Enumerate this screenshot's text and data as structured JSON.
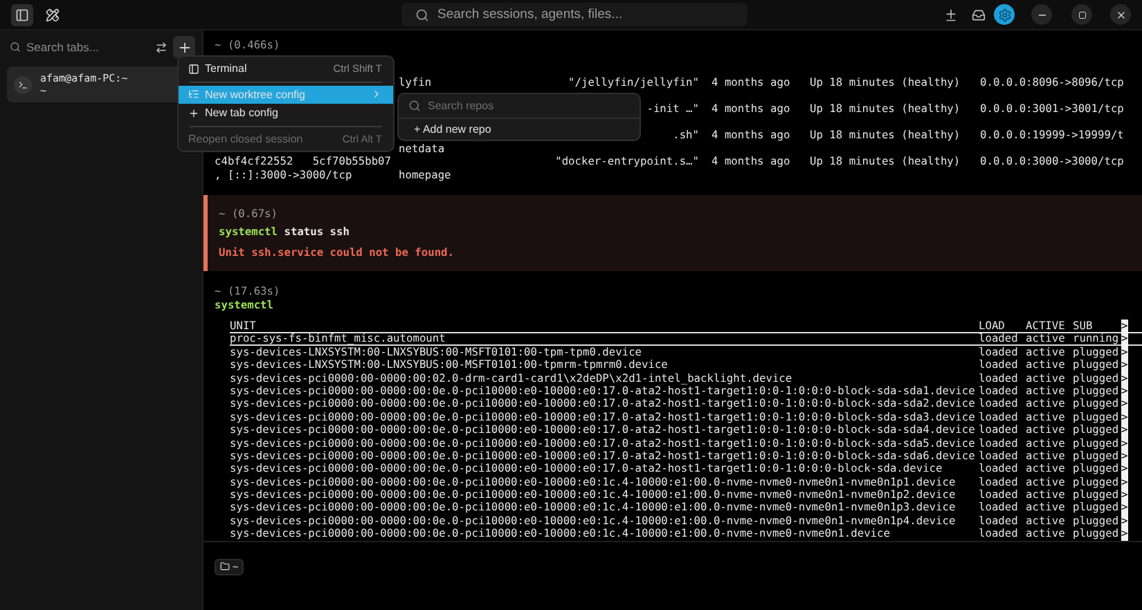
{
  "topbar": {
    "search_placeholder": "Search sessions, agents, files..."
  },
  "sidebar": {
    "search_placeholder": "Search tabs...",
    "sessions": [
      {
        "title": "afam@afam-PC:~",
        "subtitle": "~",
        "selected": true
      }
    ]
  },
  "terminal": {
    "blocks": [
      {
        "kind": "output",
        "timing": "~ (0.466s)",
        "rows": [
          {
            "line_1": {
              "column_2": "lyfin",
              "column_3": "\"/jellyfin/jellyfin\"",
              "column_4": "4 months ago",
              "column_5": "Up 18 minutes (healthy)",
              "column_6": "0.0.0.0:8096->8096/tcp"
            }
          },
          {
            "line_1": {
              "column_3": "-init …\"",
              "column_4": "4 months ago",
              "column_5": "Up 18 minutes (healthy)",
              "column_6": "0.0.0.0:3001->3001/tcp"
            }
          },
          {
            "line_1": {
              "column_3": ".sh\"",
              "column_4": "4 months ago",
              "column_5": "Up 18 minutes (healthy)",
              "column_6": "0.0.0.0:19999->19999/t"
            },
            "line_2": {
              "column_2": "netdata"
            }
          },
          {
            "line_1": {
              "column_1": "c4bf4cf22552   5cf70b55bb07",
              "column_3": "\"docker-entrypoint.s…\"",
              "column_4": "4 months ago",
              "column_5": "Up 18 minutes (healthy)",
              "column_6": "0.0.0.0:3000->3000/tcp"
            },
            "line_2": {
              "column_1": ", [::]:3000->3000/tcp",
              "column_2": "homepage"
            }
          }
        ]
      },
      {
        "kind": "error",
        "timing": "~ (0.67s)",
        "command": "systemctl",
        "args": "status ssh",
        "error": "Unit ssh.service could not be found."
      },
      {
        "kind": "pager",
        "timing": "~ (17.63s)",
        "command": "systemctl",
        "header": {
          "unit": "UNIT",
          "load": "LOAD",
          "active": "ACTIVE",
          "sub": "SUB",
          "more": ">"
        },
        "rows": [
          {
            "unit": "proc-sys-fs-binfmt_misc.automount",
            "load": "loaded",
            "active": "active",
            "sub": "running",
            "more": ">",
            "selected": true
          },
          {
            "unit": "sys-devices-LNXSYSTM:00-LNXSYBUS:00-MSFT0101:00-tpm-tpm0.device",
            "load": "loaded",
            "active": "active",
            "sub": "plugged",
            "more": ">",
            "selected": false
          },
          {
            "unit": "sys-devices-LNXSYSTM:00-LNXSYBUS:00-MSFT0101:00-tpmrm-tpmrm0.device",
            "load": "loaded",
            "active": "active",
            "sub": "plugged",
            "more": ">",
            "selected": false
          },
          {
            "unit": "sys-devices-pci0000:00-0000:00:02.0-drm-card1-card1\\x2deDP\\x2d1-intel_backlight.device",
            "load": "loaded",
            "active": "active",
            "sub": "plugged",
            "more": ">",
            "selected": false
          },
          {
            "unit": "sys-devices-pci0000:00-0000:00:0e.0-pci10000:e0-10000:e0:17.0-ata2-host1-target1:0:0-1:0:0:0-block-sda-sda1.device",
            "load": "loaded",
            "active": "active",
            "sub": "plugged",
            "more": ">",
            "selected": false
          },
          {
            "unit": "sys-devices-pci0000:00-0000:00:0e.0-pci10000:e0-10000:e0:17.0-ata2-host1-target1:0:0-1:0:0:0-block-sda-sda2.device",
            "load": "loaded",
            "active": "active",
            "sub": "plugged",
            "more": ">",
            "selected": false
          },
          {
            "unit": "sys-devices-pci0000:00-0000:00:0e.0-pci10000:e0-10000:e0:17.0-ata2-host1-target1:0:0-1:0:0:0-block-sda-sda3.device",
            "load": "loaded",
            "active": "active",
            "sub": "plugged",
            "more": ">",
            "selected": false
          },
          {
            "unit": "sys-devices-pci0000:00-0000:00:0e.0-pci10000:e0-10000:e0:17.0-ata2-host1-target1:0:0-1:0:0:0-block-sda-sda4.device",
            "load": "loaded",
            "active": "active",
            "sub": "plugged",
            "more": ">",
            "selected": false
          },
          {
            "unit": "sys-devices-pci0000:00-0000:00:0e.0-pci10000:e0-10000:e0:17.0-ata2-host1-target1:0:0-1:0:0:0-block-sda-sda5.device",
            "load": "loaded",
            "active": "active",
            "sub": "plugged",
            "more": ">",
            "selected": false
          },
          {
            "unit": "sys-devices-pci0000:00-0000:00:0e.0-pci10000:e0-10000:e0:17.0-ata2-host1-target1:0:0-1:0:0:0-block-sda-sda6.device",
            "load": "loaded",
            "active": "active",
            "sub": "plugged",
            "more": ">",
            "selected": false
          },
          {
            "unit": "sys-devices-pci0000:00-0000:00:0e.0-pci10000:e0-10000:e0:17.0-ata2-host1-target1:0:0-1:0:0:0-block-sda.device",
            "load": "loaded",
            "active": "active",
            "sub": "plugged",
            "more": ">",
            "selected": false
          },
          {
            "unit": "sys-devices-pci0000:00-0000:00:0e.0-pci10000:e0-10000:e0:1c.4-10000:e1:00.0-nvme-nvme0-nvme0n1-nvme0n1p1.device",
            "load": "loaded",
            "active": "active",
            "sub": "plugged",
            "more": ">",
            "selected": false
          },
          {
            "unit": "sys-devices-pci0000:00-0000:00:0e.0-pci10000:e0-10000:e0:1c.4-10000:e1:00.0-nvme-nvme0-nvme0n1-nvme0n1p2.device",
            "load": "loaded",
            "active": "active",
            "sub": "plugged",
            "more": ">",
            "selected": false
          },
          {
            "unit": "sys-devices-pci0000:00-0000:00:0e.0-pci10000:e0-10000:e0:1c.4-10000:e1:00.0-nvme-nvme0-nvme0n1-nvme0n1p3.device",
            "load": "loaded",
            "active": "active",
            "sub": "plugged",
            "more": ">",
            "selected": false
          },
          {
            "unit": "sys-devices-pci0000:00-0000:00:0e.0-pci10000:e0-10000:e0:1c.4-10000:e1:00.0-nvme-nvme0-nvme0n1-nvme0n1p4.device",
            "load": "loaded",
            "active": "active",
            "sub": "plugged",
            "more": ">",
            "selected": false
          },
          {
            "unit": "sys-devices-pci0000:00-0000:00:0e.0-pci10000:e0-10000:e0:1c.4-10000:e1:00.0-nvme-nvme0-nvme0n1.device",
            "load": "loaded",
            "active": "active",
            "sub": "plugged",
            "more": ">",
            "selected": false
          }
        ]
      }
    ]
  },
  "menu": {
    "items": [
      {
        "kind": "item",
        "label": "Terminal",
        "shortcut": "Ctrl Shift T",
        "selected": false,
        "disabled": false
      },
      {
        "kind": "divider"
      },
      {
        "kind": "item",
        "label": "New worktree config",
        "has_submenu": true,
        "selected": true,
        "disabled": false
      },
      {
        "kind": "item",
        "label": "New tab config",
        "selected": false,
        "disabled": false
      },
      {
        "kind": "divider"
      },
      {
        "kind": "item",
        "label": "Reopen closed session",
        "shortcut": "Ctrl Alt T",
        "selected": false,
        "disabled": true
      }
    ]
  },
  "submenu": {
    "search_placeholder": "Search repos",
    "items": [
      {
        "label": "+ Add new repo"
      }
    ]
  },
  "bottom_bar": {
    "cwd": "~"
  }
}
